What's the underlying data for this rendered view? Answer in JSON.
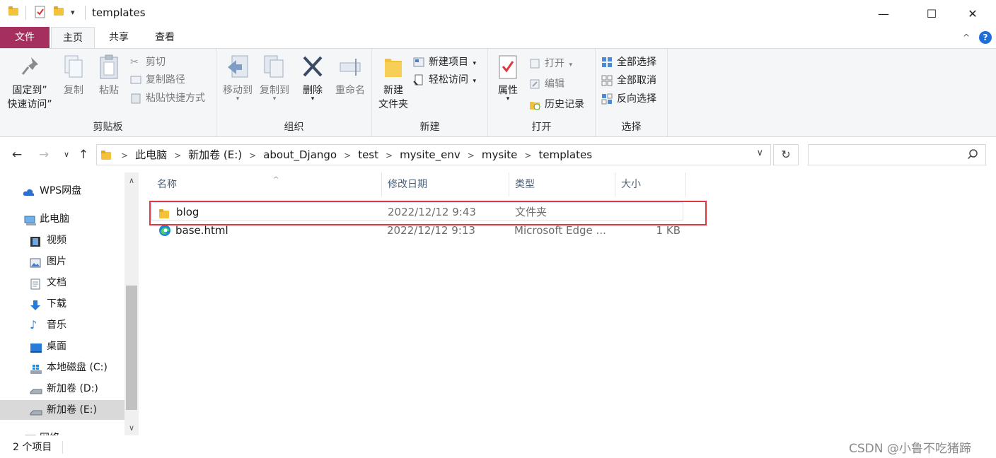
{
  "window": {
    "title": "templates",
    "minimize": "—",
    "maximize": "☐",
    "close": "✕"
  },
  "tabs": {
    "file": "文件",
    "home": "主页",
    "share": "共享",
    "view": "查看",
    "collapse": "^",
    "help": "?"
  },
  "ribbon": {
    "clipboard": {
      "pin": "固定到\"\n快速访问\"",
      "pin_line1": "固定到”",
      "pin_line2": "快速访问”",
      "copy": "复制",
      "paste": "粘贴",
      "cut": "剪切",
      "copy_path": "复制路径",
      "paste_shortcut": "粘贴快捷方式",
      "label": "剪贴板"
    },
    "organize": {
      "move_to": "移动到",
      "copy_to": "复制到",
      "delete": "删除",
      "rename": "重命名",
      "label": "组织"
    },
    "new": {
      "new_folder_line1": "新建",
      "new_folder_line2": "文件夹",
      "new_item": "新建项目",
      "easy_access": "轻松访问",
      "label": "新建"
    },
    "open": {
      "properties": "属性",
      "open": "打开",
      "edit": "编辑",
      "history": "历史记录",
      "label": "打开"
    },
    "select": {
      "select_all": "全部选择",
      "select_none": "全部取消",
      "invert": "反向选择",
      "label": "选择"
    }
  },
  "address": {
    "crumbs": [
      "此电脑",
      "新加卷 (E:)",
      "about_Django",
      "test",
      "mysite_env",
      "mysite",
      "templates"
    ],
    "search_placeholder": ""
  },
  "nav": {
    "items": [
      {
        "label": "WPS网盘",
        "icon": "cloud-icon"
      },
      {
        "label": "此电脑",
        "icon": "computer-icon"
      },
      {
        "label": "视频",
        "icon": "video-icon"
      },
      {
        "label": "图片",
        "icon": "picture-icon"
      },
      {
        "label": "文档",
        "icon": "document-icon"
      },
      {
        "label": "下载",
        "icon": "download-icon"
      },
      {
        "label": "音乐",
        "icon": "music-icon"
      },
      {
        "label": "桌面",
        "icon": "desktop-icon"
      },
      {
        "label": "本地磁盘 (C:)",
        "icon": "windows-drive-icon"
      },
      {
        "label": "新加卷 (D:)",
        "icon": "drive-icon"
      },
      {
        "label": "新加卷 (E:)",
        "icon": "drive-icon",
        "selected": true
      },
      {
        "label": "网络",
        "icon": "network-icon"
      }
    ]
  },
  "list": {
    "columns": [
      "名称",
      "修改日期",
      "类型",
      "大小"
    ],
    "rows": [
      {
        "name": "blog",
        "date": "2022/12/12 9:43",
        "type": "文件夹",
        "size": "",
        "icon": "folder-icon"
      },
      {
        "name": "base.html",
        "date": "2022/12/12 9:13",
        "type": "Microsoft Edge ...",
        "size": "1 KB",
        "icon": "edge-icon"
      }
    ]
  },
  "status": {
    "count": "2 个项目"
  },
  "watermark": "CSDN @小鲁不吃猪蹄",
  "colors": {
    "file_tab": "#a5305f",
    "highlight_box": "#e0383e",
    "folder": "#f3c13a",
    "selection": "#cce8ff"
  }
}
